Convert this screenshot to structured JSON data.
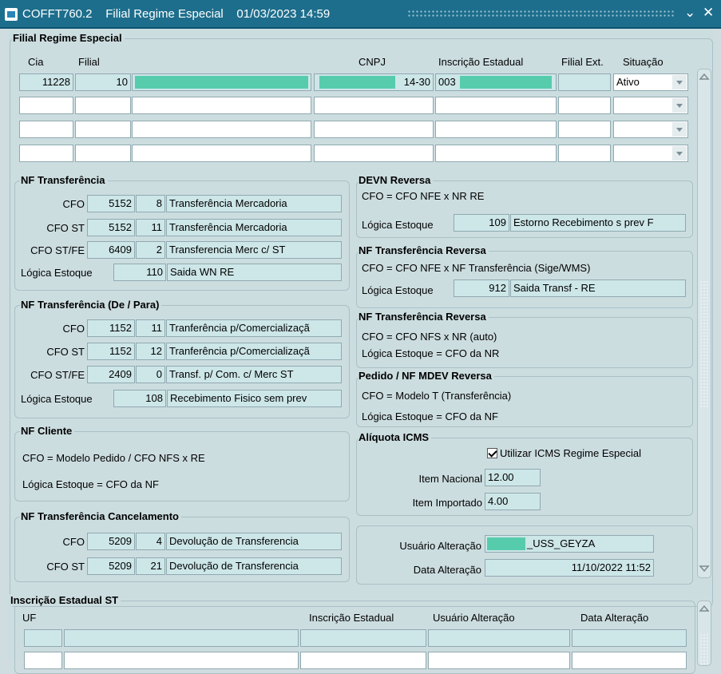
{
  "window": {
    "title": "COFFT760.2    Filial Regime Especial    01/03/2023 14:59"
  },
  "main": {
    "title": "Filial Regime Especial",
    "headers": {
      "cia": "Cia",
      "filial": "Filial",
      "cnpj": "CNPJ",
      "ie": "Inscrição Estadual",
      "ext": "Filial Ext.",
      "situacao": "Situação"
    },
    "row": {
      "cia": "11228",
      "filial": "10",
      "cnpj_suffix": "14-30",
      "ie_prefix": "003",
      "situacao": "Ativo"
    }
  },
  "nf_transf": {
    "title": "NF Transferência",
    "rows": [
      {
        "label": "CFO",
        "cfo": "5152",
        "seq": "8",
        "desc": "Transferência Mercadoria"
      },
      {
        "label": "CFO ST",
        "cfo": "5152",
        "seq": "11",
        "desc": "Transferência Mercadoria"
      },
      {
        "label": "CFO ST/FE",
        "cfo": "6409",
        "seq": "2",
        "desc": "Transferencia Merc c/ ST"
      }
    ],
    "logica_label": "Lógica Estoque",
    "logica_code": "110",
    "logica_desc": "Saida WN RE"
  },
  "nf_transf_depara": {
    "title": "NF Transferência (De / Para)",
    "rows": [
      {
        "label": "CFO",
        "cfo": "1152",
        "seq": "11",
        "desc": "Tranferência p/Comercializaçã"
      },
      {
        "label": "CFO ST",
        "cfo": "1152",
        "seq": "12",
        "desc": "Tranferência p/Comercializaçã"
      },
      {
        "label": "CFO ST/FE",
        "cfo": "2409",
        "seq": "0",
        "desc": "Transf. p/ Com. c/ Merc ST"
      }
    ],
    "logica_label": "Lógica Estoque",
    "logica_code": "108",
    "logica_desc": "Recebimento Fisico sem prev"
  },
  "nf_cliente": {
    "title": "NF Cliente",
    "line1": "CFO  =  Modelo Pedido  /  CFO NFS  x  RE",
    "line2": "Lógica Estoque  =  CFO da NF"
  },
  "nf_cancel": {
    "title": "NF Transferência Cancelamento",
    "rows": [
      {
        "label": "CFO",
        "cfo": "5209",
        "seq": "4",
        "desc": "Devolução de Transferencia"
      },
      {
        "label": "CFO ST",
        "cfo": "5209",
        "seq": "21",
        "desc": "Devolução de Transferencia"
      }
    ]
  },
  "devn": {
    "title": "DEVN Reversa",
    "line": "CFO  =  CFO NFE  x  NR RE",
    "logica_label": "Lógica Estoque",
    "logica_code": "109",
    "logica_desc": "Estorno Recebimento s prev F"
  },
  "nf_rev1": {
    "title": "NF Transferência Reversa",
    "line": "CFO  =  CFO NFE  x  NF Transferência (Sige/WMS)",
    "logica_label": "Lógica Estoque",
    "logica_code": "912",
    "logica_desc": "Saida Transf - RE"
  },
  "nf_rev2": {
    "title": "NF Transferência Reversa",
    "line1": "CFO  =  CFO NFS  x  NR (auto)",
    "line2": "Lógica Estoque  =  CFO da NR"
  },
  "pedido": {
    "title": "Pedido / NF MDEV Reversa",
    "line1": "CFO  =  Modelo T (Transferência)",
    "line2": "Lógica Estoque  =  CFO da NF"
  },
  "icms": {
    "title": "Alíquota ICMS",
    "checkbox_label": "Utilizar ICMS Regime Especial",
    "checked": true,
    "nacional_label": "Item Nacional",
    "nacional": "12.00",
    "importado_label": "Item Importado",
    "importado": "4.00"
  },
  "audit": {
    "user_label": "Usuário Alteração",
    "user_value": "_USS_GEYZA",
    "date_label": "Data Alteração",
    "date_value": "11/10/2022 11:52"
  },
  "ie_st": {
    "title": "Inscrição Estadual ST",
    "headers": {
      "uf": "UF",
      "ie": "Inscrição Estadual",
      "user": "Usuário Alteração",
      "date": "Data Alteração"
    }
  },
  "colors": {
    "titlebar": "#1d6e8c",
    "background": "#ccdde0",
    "field": "#cde6e8",
    "mask": "#57ccad"
  }
}
